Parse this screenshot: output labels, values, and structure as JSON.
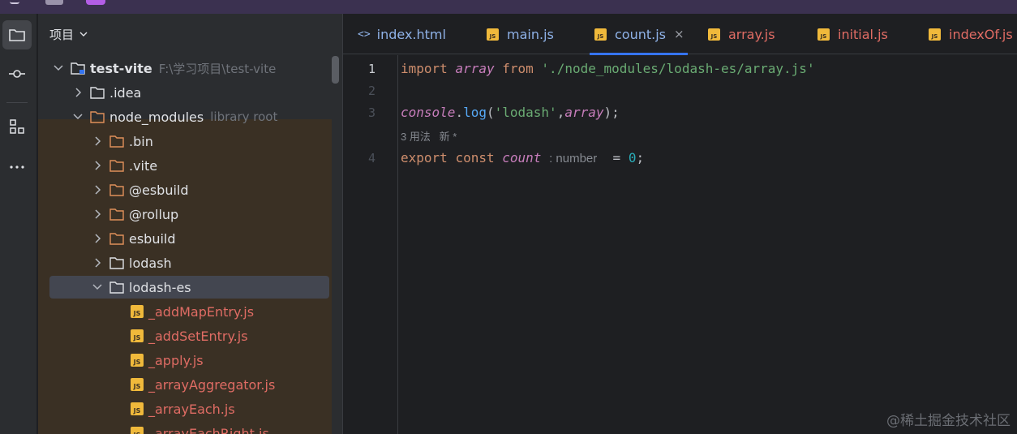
{
  "project_panel": {
    "title": "项目",
    "tree": [
      {
        "label": "test-vite",
        "hint": "F:\\学习项目\\test-vite",
        "type": "module"
      },
      {
        "label": ".idea",
        "hint": "",
        "type": "folder"
      },
      {
        "label": "node_modules",
        "hint": "library root",
        "type": "folder"
      },
      {
        "label": ".bin",
        "hint": "",
        "type": "folder"
      },
      {
        "label": ".vite",
        "hint": "",
        "type": "folder"
      },
      {
        "label": "@esbuild",
        "hint": "",
        "type": "folder"
      },
      {
        "label": "@rollup",
        "hint": "",
        "type": "folder"
      },
      {
        "label": "esbuild",
        "hint": "",
        "type": "folder"
      },
      {
        "label": "lodash",
        "hint": "",
        "type": "folder"
      },
      {
        "label": "lodash-es",
        "hint": "",
        "type": "folder"
      },
      {
        "label": "_addMapEntry.js",
        "hint": "",
        "type": "js"
      },
      {
        "label": "_addSetEntry.js",
        "hint": "",
        "type": "js"
      },
      {
        "label": "_apply.js",
        "hint": "",
        "type": "js"
      },
      {
        "label": "_arrayAggregator.js",
        "hint": "",
        "type": "js"
      },
      {
        "label": "_arrayEach.js",
        "hint": "",
        "type": "js"
      },
      {
        "label": "_arrayEachRight.js",
        "hint": "",
        "type": "js"
      }
    ]
  },
  "tabs": [
    {
      "label": "index.html",
      "kind": "html"
    },
    {
      "label": "main.js",
      "kind": "js"
    },
    {
      "label": "count.js",
      "kind": "js",
      "active": true
    },
    {
      "label": "array.js",
      "kind": "js"
    },
    {
      "label": "initial.js",
      "kind": "js"
    },
    {
      "label": "indexOf.js",
      "kind": "js"
    }
  ],
  "tab_js_badge": "JS",
  "tab_html_badge": "<>",
  "tab_close": "×",
  "editor": {
    "line_numbers": [
      "1",
      "2",
      "3",
      "4"
    ],
    "line1": {
      "kw_import": "import",
      "var_array": "array",
      "kw_from": "from",
      "str_path": "'./node_modules/lodash-es/array.js'"
    },
    "line3": {
      "console": "console",
      "dot": ".",
      "fn_log": "log",
      "open": "(",
      "str_lodash": "'lodash'",
      "comma": ",",
      "var_array": "array",
      "close": ");"
    },
    "usage_hint": "3 用法   新 *",
    "line4": {
      "kw_export": "export",
      "kw_const": "const",
      "var_count": "count",
      "inlay_type": ": number",
      "eq": "=",
      "num": "0",
      "semi": ";"
    }
  },
  "watermark": "@稀土掘金技术社区",
  "colors": {
    "accent": "#3574f0",
    "keyword": "#cf8e6d",
    "string": "#6aab73",
    "js_badge": "#f0b93b"
  }
}
